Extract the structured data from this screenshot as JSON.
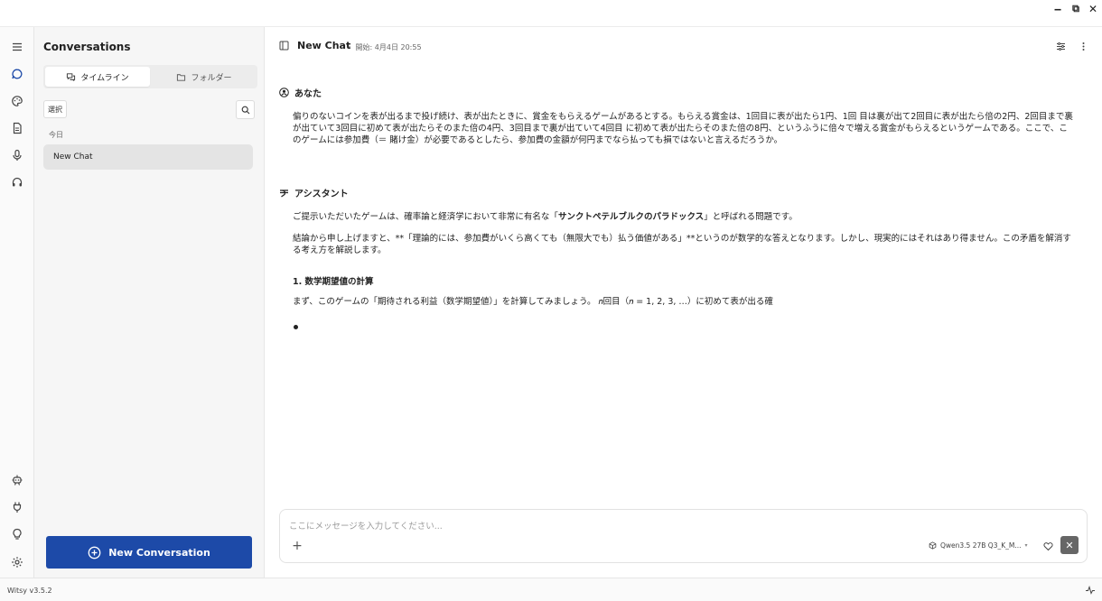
{
  "window": {
    "min": "‒",
    "max": "⧉",
    "close": "✕"
  },
  "rail": {
    "icons": [
      "menu-icon",
      "chat-icon",
      "palette-icon",
      "document-icon",
      "microphone-icon",
      "headset-icon",
      "agent-icon",
      "plug-icon",
      "bulb-icon",
      "settings-icon"
    ]
  },
  "sidebar": {
    "title": "Conversations",
    "tabs": [
      {
        "label": "タイムライン",
        "active": true
      },
      {
        "label": "フォルダー",
        "active": false
      }
    ],
    "select_label": "選択",
    "group_label": "今日",
    "items": [
      {
        "label": "New Chat",
        "selected": true
      }
    ],
    "new_button": "New Conversation"
  },
  "chat": {
    "title": "New Chat",
    "subtitle": "・ 開始: 4月4日 20:55",
    "user": {
      "role": "あなた",
      "text": "偏りのないコインを表が出るまで投げ続け、表が出たときに、賞金をもらえるゲームがあるとする。もらえる賞金は、1回目に表が出たら1円、1回 目は裏が出て2回目に表が出たら倍の2円、2回目まで裏が出ていて3回目に初めて表が出たらそのまた倍の4円、3回目まで裏が出ていて4回目 に初めて表が出たらそのまた倍の8円、というふうに倍々で増える賞金がもらえるというゲームである。ここで、このゲームには参加費（＝ 賭け金）が必要であるとしたら、参加費の金額が何円までなら払っても損ではないと言えるだろうか。"
    },
    "assistant": {
      "role": "アシスタント",
      "p1_a": "ご提示いただいたゲームは、確率論と経済学において非常に有名な「",
      "p1_bold": "サンクトペテルブルクのパラドックス",
      "p1_b": "」と呼ばれる問題です。",
      "p2": "結論から申し上げますと、**「理論的には、参加費がいくら高くても（無限大でも）払う価値がある」**というのが数学的な答えとなります。しかし、現実的にはそれはあり得ません。この矛盾を解消する考え方を解説します。",
      "h1": "1. 数学期望値の計算",
      "p3": "まず、このゲームの「期待される利益（数学期望値）」を計算してみましょう。 𝑛回目（𝑛 = 1, 2, 3, …）に初めて表が出る確"
    }
  },
  "composer": {
    "placeholder": "ここにメッセージを入力してください...",
    "plus": "+",
    "model": "Qwen3.5 27B Q3_K_M...",
    "stop": "✕"
  },
  "status": {
    "version": "Witsy v3.5.2"
  },
  "colors": {
    "primary": "#1d4aa8",
    "sidebar_bg": "#f6f6f6",
    "selected_bg": "#e4e4e4"
  }
}
